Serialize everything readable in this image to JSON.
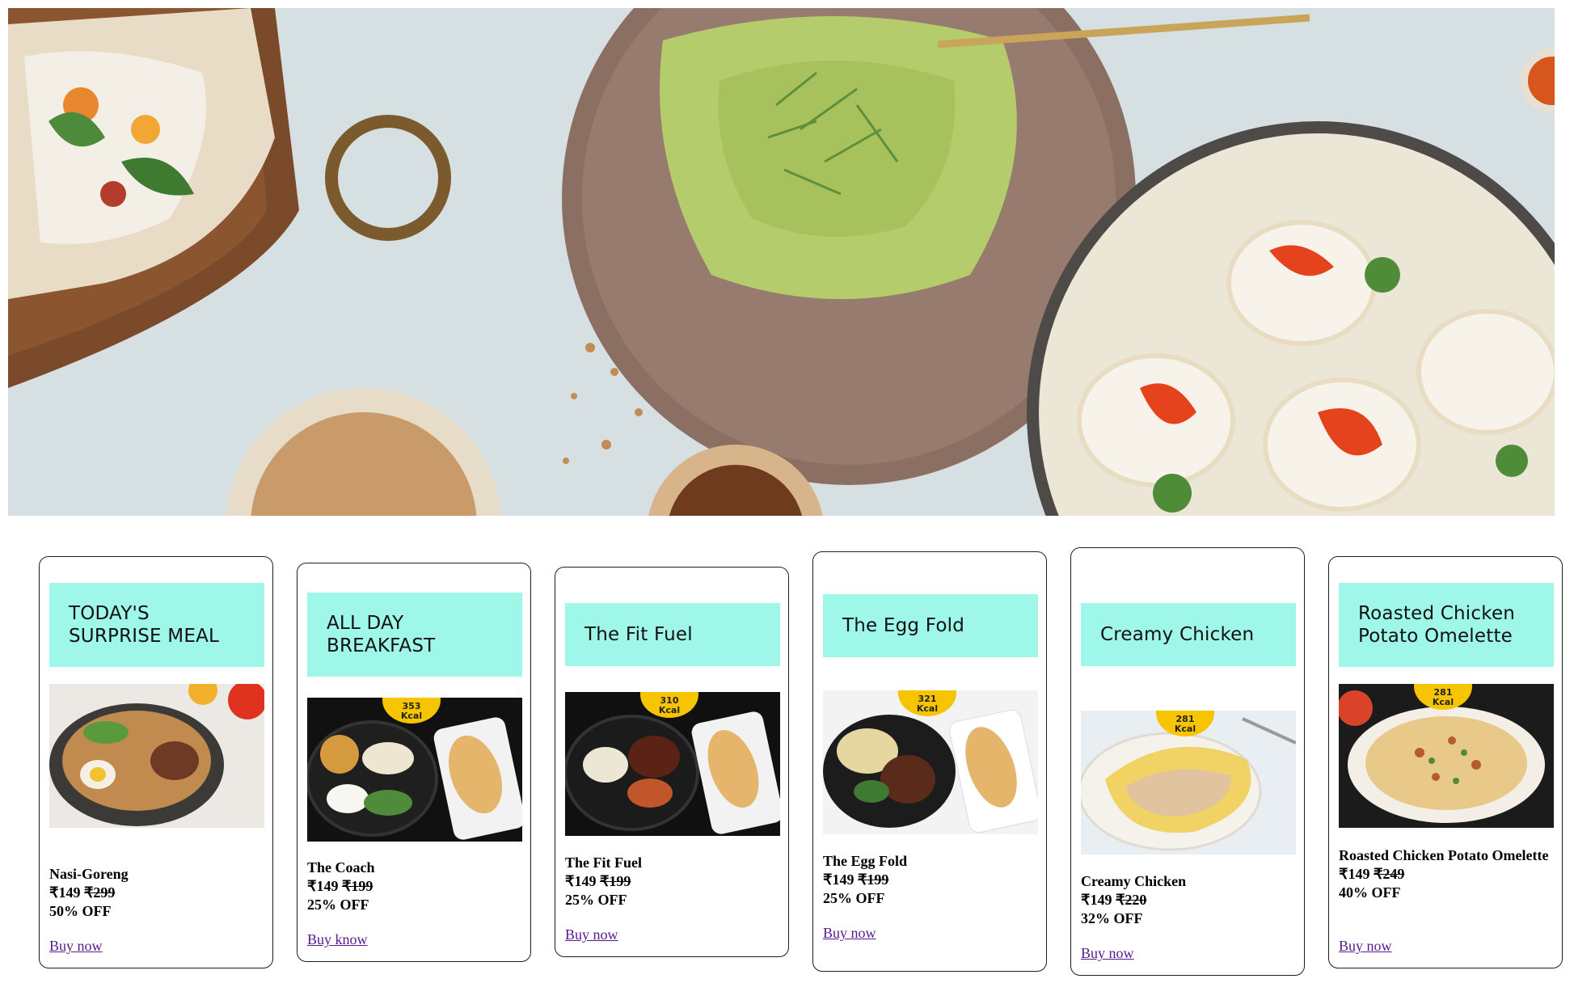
{
  "hero": {
    "image": "food-flatlay-banner"
  },
  "cards": [
    {
      "title": "TODAY'S SURPRISE MEAL",
      "name": "Nasi-Goreng",
      "price": "₹149",
      "old_price": "₹299",
      "discount": "50% OFF",
      "kcal": "",
      "kcal_unit": "",
      "cta": "Buy now"
    },
    {
      "title": "ALL DAY BREAKFAST",
      "name": "The Coach",
      "price": "₹149",
      "old_price": "₹199",
      "discount": "25% OFF",
      "kcal": "353",
      "kcal_unit": "Kcal",
      "cta": "Buy know"
    },
    {
      "title": "The Fit Fuel",
      "name": "The Fit Fuel",
      "price": "₹149",
      "old_price": "₹199",
      "discount": "25% OFF",
      "kcal": "310",
      "kcal_unit": "Kcal",
      "cta": "Buy now"
    },
    {
      "title": "The Egg Fold",
      "name": "The Egg Fold",
      "price": "₹149",
      "old_price": "₹199",
      "discount": "25% OFF",
      "kcal": "321",
      "kcal_unit": "Kcal",
      "cta": "Buy now"
    },
    {
      "title": "Creamy Chicken",
      "name": "Creamy Chicken",
      "price": "₹149",
      "old_price": "₹220",
      "discount": "32% OFF",
      "kcal": "281",
      "kcal_unit": "Kcal",
      "cta": "Buy now"
    },
    {
      "title": "Roasted Chicken Potato Omelette",
      "name": "Roasted Chicken Potato Omelette",
      "price": "₹149",
      "old_price": "₹249",
      "discount": "40% OFF",
      "kcal": "281",
      "kcal_unit": "Kcal",
      "cta": "Buy now"
    }
  ],
  "colors": {
    "title_band": "#9ff7ea",
    "kcal_badge": "#f6c400",
    "link": "#551a8b"
  }
}
